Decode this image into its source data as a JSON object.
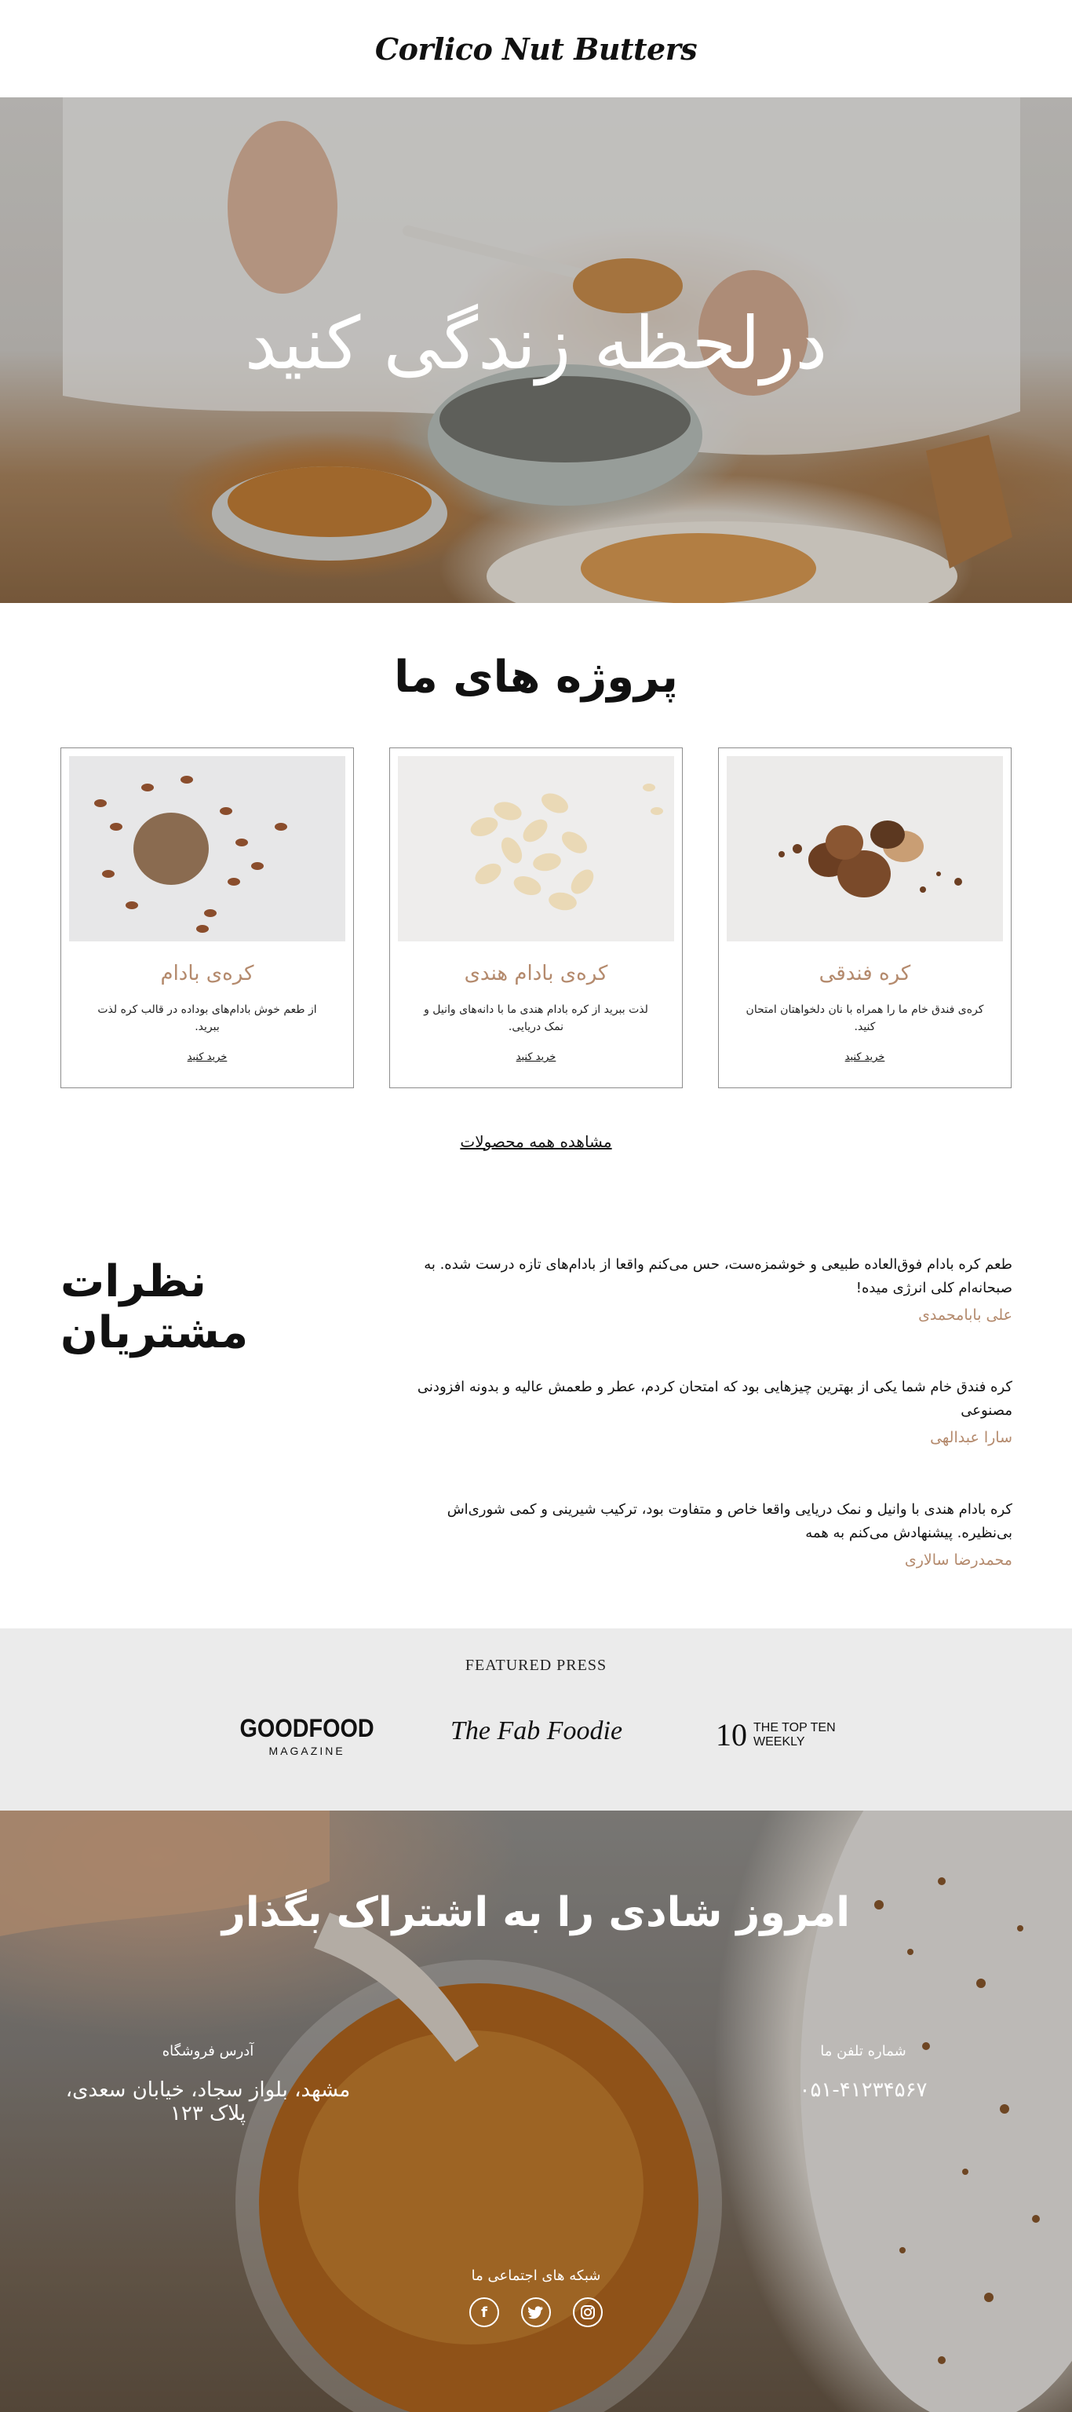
{
  "brand": {
    "name": "Corlico Nut Butters"
  },
  "hero": {
    "title": "درلحظه زندگی کنید"
  },
  "products": {
    "title": "پروژه های ما",
    "items": [
      {
        "name": "کره فندقی",
        "description": "کره‌ی فندق خام ما را همراه با نان دلخواهتان امتحان کنید.",
        "cta": "خرید کنید"
      },
      {
        "name": "کره‌ی بادام هندی",
        "description": "لذت ببرید از کره بادام هندی ما با دانه‌های وانیل و نمک دریایی.",
        "cta": "خرید کنید"
      },
      {
        "name": "کره‌ی بادام",
        "description": "از طعم خوش بادام‌های بوداده در قالب کره لذت ببرید.",
        "cta": "خرید کنید"
      }
    ],
    "view_all": "مشاهده همه محصولات"
  },
  "testimonials": {
    "title": "نظرات مشتریان",
    "items": [
      {
        "quote": "طعم کره بادام فوق‌العاده طبیعی و خوشمزه‌ست، حس می‌کنم واقعا از بادام‌های تازه درست شده. به صبحانه‌ام کلی انرژی میده!",
        "author": "علی بابامحمدی"
      },
      {
        "quote": "کره فندق خام شما یکی از بهترین چیزهایی بود که امتحان کردم، عطر و طعمش عالیه و بدونه افزودنی مصنوعی",
        "author": "سارا عبدالهی"
      },
      {
        "quote": "کره بادام هندی با وانیل و نمک دریایی واقعا خاص و متفاوت بود، ترکیب شیرینی و کمی شوری‌اش بی‌نظیره. پیشنهادش می‌کنم به همه",
        "author": "محمدرضا سالاری"
      }
    ]
  },
  "press": {
    "title": "FEATURED PRESS",
    "goodfood_big": "GOODFOOD",
    "goodfood_small": "MAGAZINE",
    "fab_foodie": "The Fab Foodie",
    "topten_num": "10",
    "topten_line1": "THE TOP TEN",
    "topten_line2": "WEEKLY"
  },
  "footer": {
    "title": "امروز شادی را به اشتراک بگذار",
    "phone_label": "شماره تلفن ما",
    "phone_value": "۰۵۱-۴۱۲۳۴۵۶۷",
    "address_label": "آدرس فروشگاه",
    "address_value": "مشهد، بلواز سجاد، خیابان سعدی، پلاک ۱۲۳",
    "social_label": "شبکه های اجتماعی ما",
    "social_icons": [
      "facebook-icon",
      "twitter-icon",
      "instagram-icon"
    ]
  }
}
